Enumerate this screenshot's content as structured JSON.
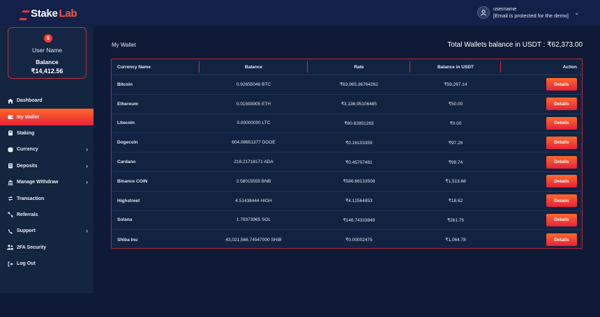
{
  "brand": {
    "name_part1": "Stake",
    "name_part2": "Lab"
  },
  "header": {
    "username": "username",
    "email": "[Email is protected for the demo]"
  },
  "profile": {
    "name": "User Name",
    "balance_label": "Balance",
    "balance": "₹14,412.56"
  },
  "sidebar": {
    "items": [
      {
        "label": "Dashboard",
        "icon": "home-icon",
        "chevron": false
      },
      {
        "label": "My Wallet",
        "icon": "wallet-icon",
        "chevron": false,
        "active": true
      },
      {
        "label": "Staking",
        "icon": "staking-icon",
        "chevron": false
      },
      {
        "label": "Currency",
        "icon": "currency-icon",
        "chevron": true
      },
      {
        "label": "Deposits",
        "icon": "deposits-icon",
        "chevron": true
      },
      {
        "label": "Manage Withdraw",
        "icon": "withdraw-icon",
        "chevron": true
      },
      {
        "label": "Transaction",
        "icon": "transaction-icon",
        "chevron": false
      },
      {
        "label": "Referrals",
        "icon": "referrals-icon",
        "chevron": false
      },
      {
        "label": "Support",
        "icon": "support-icon",
        "chevron": true
      },
      {
        "label": "2FA Security",
        "icon": "security-icon",
        "chevron": false
      },
      {
        "label": "Log Out",
        "icon": "logout-icon",
        "chevron": false
      }
    ]
  },
  "main": {
    "title": "My Wallet",
    "total_balance": "Total Wallets balance in USDT : ₹62,373.00"
  },
  "table": {
    "columns": [
      "Currency Name",
      "Balance",
      "Rate",
      "Balance in USDT",
      "Action"
    ],
    "button_label": "Details",
    "rows": [
      {
        "name": "Bitcoin",
        "balance": "0.92655046 BTC",
        "rate": "₹63,965.36764262",
        "usdt": "₹59,267.14"
      },
      {
        "name": "Ethereum",
        "balance": "0.01593905 ETH",
        "rate": "₹3,136.95106485",
        "usdt": "₹50.00"
      },
      {
        "name": "Litecoin",
        "balance": "0.00000000 LTC",
        "rate": "₹80.82851283",
        "usdt": "₹0.00"
      },
      {
        "name": "Dogecoin",
        "balance": "604.08651377 DOGE",
        "rate": "₹0.16103359",
        "usdt": "₹97.28"
      },
      {
        "name": "Cardano",
        "balance": "218.21718171 ADA",
        "rate": "₹0.45707481",
        "usdt": "₹99.74"
      },
      {
        "name": "Binance COIN",
        "balance": "2.58015555 BNB",
        "rate": "₹586.66133508",
        "usdt": "₹1,513.68"
      },
      {
        "name": "Highstreet",
        "balance": "4.51438444 HIGH",
        "rate": "₹4.12564853",
        "usdt": "₹18.62"
      },
      {
        "name": "Solana",
        "balance": "1.78373965 SOL",
        "rate": "₹146.74333849",
        "usdt": "₹261.75"
      },
      {
        "name": "Shiba Inu",
        "balance": "43,021,566.74547000 SHIB",
        "rate": "₹0.00002475",
        "usdt": "₹1,064.78"
      }
    ]
  }
}
